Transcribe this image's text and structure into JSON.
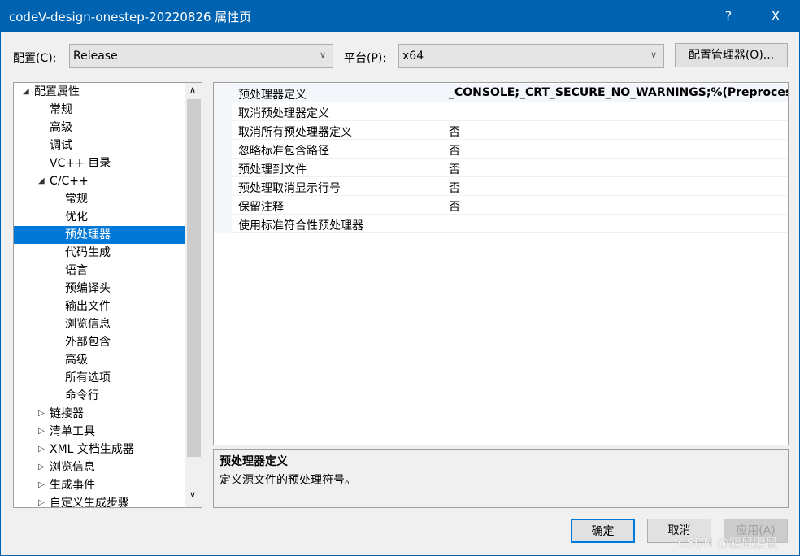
{
  "window": {
    "title": "codeV-design-onestep-20220826 属性页",
    "help": "?",
    "close": "X"
  },
  "toolbar": {
    "config_label": "配置(C):",
    "config_value": "Release",
    "platform_label": "平台(P):",
    "platform_value": "x64",
    "config_manager": "配置管理器(O)..."
  },
  "tree": [
    {
      "label": "配置属性",
      "level": 0,
      "arrow": "◢"
    },
    {
      "label": "常规",
      "level": 1
    },
    {
      "label": "高级",
      "level": 1
    },
    {
      "label": "调试",
      "level": 1
    },
    {
      "label": "VC++ 目录",
      "level": 1
    },
    {
      "label": "C/C++",
      "level": 1,
      "arrow": "◢"
    },
    {
      "label": "常规",
      "level": 2
    },
    {
      "label": "优化",
      "level": 2
    },
    {
      "label": "预处理器",
      "level": 2,
      "selected": true
    },
    {
      "label": "代码生成",
      "level": 2
    },
    {
      "label": "语言",
      "level": 2
    },
    {
      "label": "预编译头",
      "level": 2
    },
    {
      "label": "输出文件",
      "level": 2
    },
    {
      "label": "浏览信息",
      "level": 2
    },
    {
      "label": "外部包含",
      "level": 2
    },
    {
      "label": "高级",
      "level": 2
    },
    {
      "label": "所有选项",
      "level": 2
    },
    {
      "label": "命令行",
      "level": 2
    },
    {
      "label": "链接器",
      "level": 1,
      "arrow": "▷"
    },
    {
      "label": "清单工具",
      "level": 1,
      "arrow": "▷"
    },
    {
      "label": "XML 文档生成器",
      "level": 1,
      "arrow": "▷"
    },
    {
      "label": "浏览信息",
      "level": 1,
      "arrow": "▷"
    },
    {
      "label": "生成事件",
      "level": 1,
      "arrow": "▷"
    },
    {
      "label": "自定义生成步骤",
      "level": 1,
      "arrow": "▷"
    }
  ],
  "properties": [
    {
      "name": "预处理器定义",
      "value": "_CONSOLE;_CRT_SECURE_NO_WARNINGS;%(PreprocessorDefinitions)",
      "bold": true
    },
    {
      "name": "取消预处理器定义",
      "value": ""
    },
    {
      "name": "取消所有预处理器定义",
      "value": "否"
    },
    {
      "name": "忽略标准包含路径",
      "value": "否"
    },
    {
      "name": "预处理到文件",
      "value": "否"
    },
    {
      "name": "预处理取消显示行号",
      "value": "否"
    },
    {
      "name": "保留注释",
      "value": "否"
    },
    {
      "name": "使用标准符合性预处理器",
      "value": ""
    }
  ],
  "description": {
    "title": "预处理器定义",
    "text": "定义源文件的预处理符号。"
  },
  "buttons": {
    "ok": "确定",
    "cancel": "取消",
    "apply": "应用(A)"
  },
  "watermark": "CSDN @鼹鼠鼹鼠",
  "colors": {
    "titlebar": "#0063b1",
    "selection": "#0078d7"
  }
}
